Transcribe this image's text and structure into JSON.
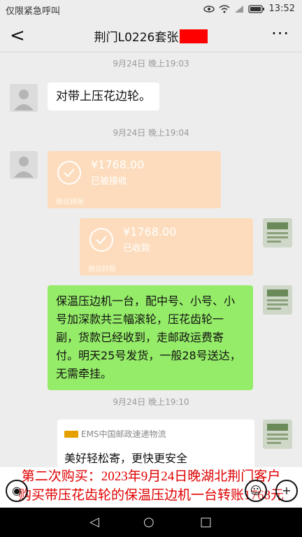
{
  "status": {
    "carrier": "仅限紧急呼叫",
    "time": "13:52",
    "icons": [
      "eye-icon",
      "wifi-icon",
      "signal-icon",
      "battery-icon"
    ]
  },
  "nav": {
    "back": "<",
    "title": "荆门L0226套张",
    "more": "···"
  },
  "timestamps": [
    "9月24日 晚上19:03",
    "9月24日 晚上19:04",
    "9月24日 晚上19:10"
  ],
  "messages": {
    "m1": "对带上压花边轮。",
    "t1": {
      "amount": "¥1768.00",
      "state": "已被接收",
      "foot": "微信转账"
    },
    "t2": {
      "amount": "¥1768.00",
      "state": "已收款",
      "foot": "微信转账"
    },
    "green": "保温压边机一台，配中号、小号、小号加深款共三幅滚轮，压花齿轮一副，货款已经收到，走邮政运费寄付。明天25号发货，一般28号送达，无需牵挂。",
    "ems": {
      "brand": "EMS中国邮政速递物流",
      "slogan": "美好轻松寄，更快更安全"
    }
  },
  "overlay": {
    "line1": "第二次购买：2023年9月24日晚湖北荆门客户",
    "line2": "购买带压花齿轮的保温压边机一台转账1768元"
  },
  "colors": {
    "green_bubble": "#95ec69",
    "transfer": "#fcdcbc",
    "overlay_text": "#e00000",
    "redaction": "#ff0000"
  }
}
